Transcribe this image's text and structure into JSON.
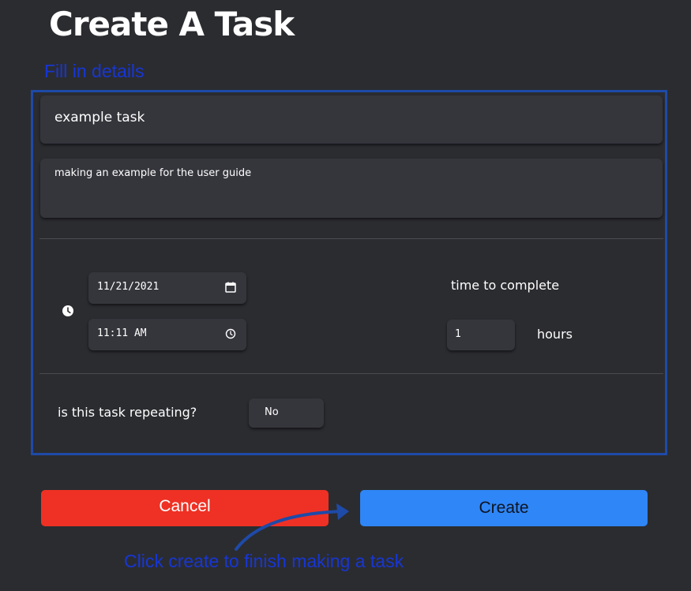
{
  "header": {
    "title": "Create A Task"
  },
  "annotations": {
    "fill_in": "Fill in details",
    "click_create": "Click create to finish making a task"
  },
  "form": {
    "task_name": "example task",
    "task_description": "making an example for the user guide",
    "date": "11/21/2021",
    "time": "11:11 AM",
    "time_to_complete_label": "time to complete",
    "hours_value": "1",
    "hours_label": "hours",
    "repeating_label": "is this task repeating?",
    "repeating_value": "No"
  },
  "buttons": {
    "cancel_label": "Cancel",
    "create_label": "Create"
  },
  "colors": {
    "background": "#2b2c30",
    "field": "#35363c",
    "cancel": "#ee3124",
    "create": "#2f86f6",
    "annotation": "#1736d4",
    "highlight_border": "#1e4aa8"
  },
  "icons": {
    "clock": "clock-icon",
    "calendar": "calendar-icon",
    "time": "time-icon",
    "arrow": "arrow-icon"
  }
}
